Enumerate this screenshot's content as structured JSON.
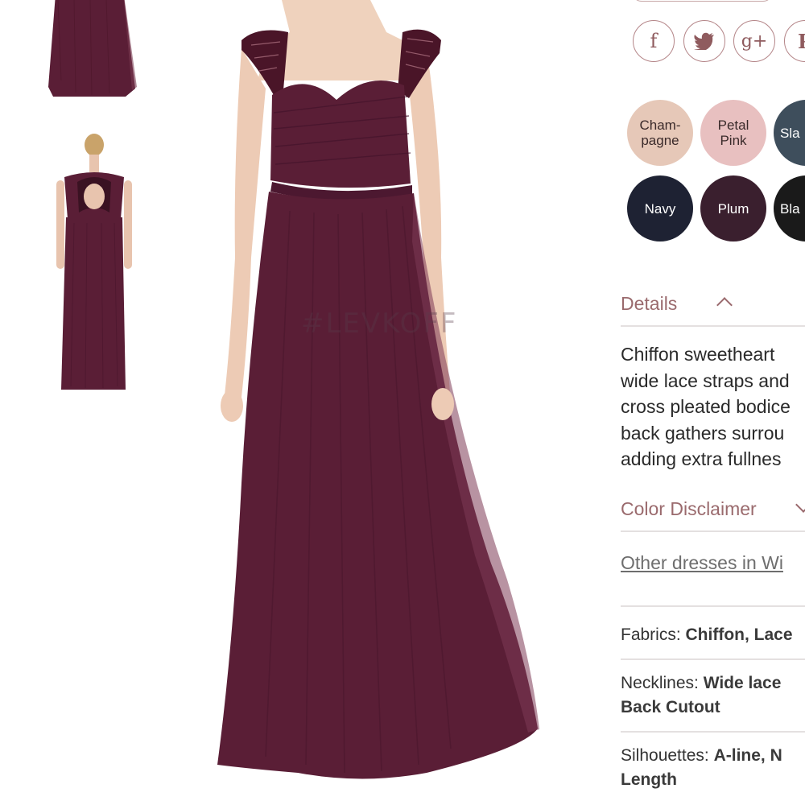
{
  "social": {
    "facebook": "f",
    "twitter": "t",
    "google_plus": "g+",
    "pinterest": "P"
  },
  "swatches": [
    {
      "label": "Cham-\npagne",
      "color": "#e6c8b8",
      "text_color": "#3a2a2a"
    },
    {
      "label": "Petal\nPink",
      "color": "#e8c0c0",
      "text_color": "#3a2a2a"
    },
    {
      "label": "Sla",
      "color": "#3e4e5c",
      "text_color": "#ffffff"
    },
    {
      "label": "Navy",
      "color": "#1e2233",
      "text_color": "#ffffff"
    },
    {
      "label": "Plum",
      "color": "#3a1f2e",
      "text_color": "#ffffff"
    },
    {
      "label": "Bla",
      "color": "#1a1a1a",
      "text_color": "#ffffff"
    }
  ],
  "details": {
    "title": "Details",
    "lines": [
      "Chiffon sweetheart ",
      "wide lace straps and",
      "cross pleated bodice",
      "back gathers surrou",
      "adding extra fullnes"
    ]
  },
  "color_disclaimer": {
    "title": "Color Disclaimer"
  },
  "other_link": "Other dresses in Wi",
  "attributes": {
    "fabrics_label": "Fabrics: ",
    "fabrics_value": "Chiffon, Lace",
    "necklines_label": "Necklines: ",
    "necklines_value_1": "Wide lace",
    "necklines_value_2": "Back Cutout",
    "silhouettes_label": "Silhouettes: ",
    "silhouettes_value_1": "A-line, N",
    "silhouettes_value_2": "Length"
  },
  "watermark": "#LEVKOFF",
  "colors": {
    "dress": "#5a1e36",
    "accent": "#9a6a6d",
    "social_border": "#b48588"
  }
}
